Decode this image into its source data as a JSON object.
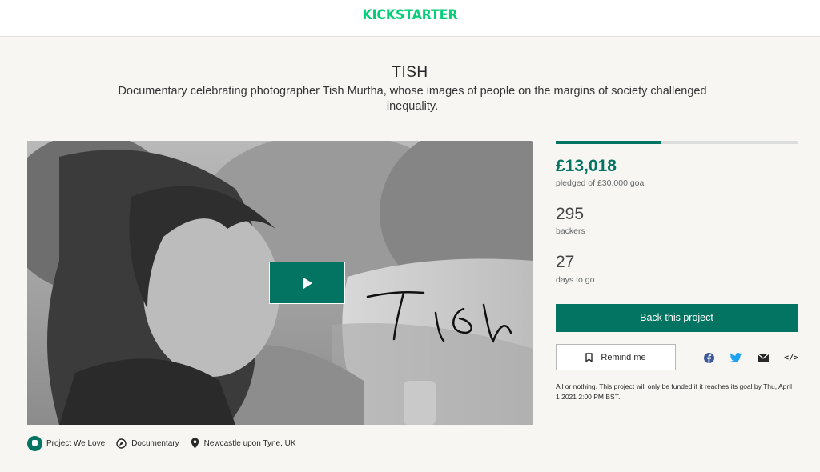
{
  "header": {
    "logo_text": "KICKSTARTER",
    "brand_color": "#05ce78"
  },
  "project": {
    "title": "TISH",
    "subtitle": "Documentary celebrating photographer Tish Murtha, whose images of people on the margins of society challenged inequality.",
    "video": {
      "signature_text": "Tish",
      "play_icon": "play-icon"
    },
    "meta": {
      "badge": "Project We Love",
      "category": "Documentary",
      "location": "Newcastle upon Tyne, UK"
    }
  },
  "funding": {
    "progress_fraction": 0.434,
    "pledged": "£13,018",
    "pledged_label": "pledged of £30,000 goal",
    "backers": "295",
    "backers_label": "backers",
    "days": "27",
    "days_label": "days to go",
    "accent_color": "#037362"
  },
  "actions": {
    "back_label": "Back this project",
    "remind_label": "Remind me",
    "share_icons": [
      "facebook-icon",
      "twitter-icon",
      "email-icon",
      "embed-icon"
    ],
    "embed_symbol": "</>"
  },
  "note": {
    "aon_label": "All or nothing.",
    "text": " This project will only be funded if it reaches its goal by Thu, April 1 2021 2:00 PM BST."
  }
}
